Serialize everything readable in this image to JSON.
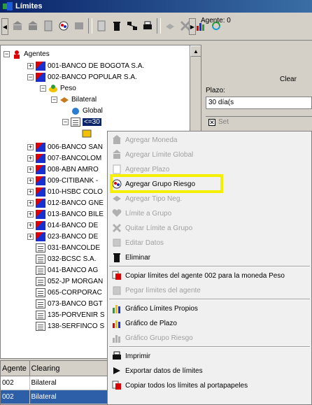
{
  "window": {
    "title": "Límites"
  },
  "toolbar": {
    "icons": [
      "bank-icon",
      "bank-icon",
      "calculator-icon",
      "group-risk-icon",
      "filter-icon",
      "document-icon",
      "trash-icon",
      "network-icon",
      "print-icon",
      "handshake-icon",
      "cross-icon",
      "chart-icon",
      "refresh-icon"
    ]
  },
  "right_pane": {
    "agente_label": "Agente: 0",
    "clear_label": "Clear",
    "plazo_label": "Plazo:",
    "plazo_value": "30 día(s",
    "check_label": "Set"
  },
  "tree": {
    "root": "Agentes",
    "nodes": [
      {
        "label": "001-BANCO DE BOGOTA S.A."
      },
      {
        "label": "002-BANCO POPULAR S.A."
      },
      {
        "label": "Peso"
      },
      {
        "label": "Bilateral"
      },
      {
        "label": "Global"
      },
      {
        "label": "<=30"
      },
      {
        "label": "006-BANCO SAN"
      },
      {
        "label": "007-BANCOLOM"
      },
      {
        "label": "008-ABN AMRO"
      },
      {
        "label": "009-CITIBANK -"
      },
      {
        "label": "010-HSBC COLO"
      },
      {
        "label": "012-BANCO GNE"
      },
      {
        "label": "013-BANCO BILE"
      },
      {
        "label": "014-BANCO DE"
      },
      {
        "label": "023-BANCO DE"
      },
      {
        "label": "031-BANCOLDE"
      },
      {
        "label": "032-BCSC S.A."
      },
      {
        "label": "041-BANCO AG"
      },
      {
        "label": "052-JP MORGAN"
      },
      {
        "label": "065-CORPORAC"
      },
      {
        "label": "073-BANCO BGT"
      },
      {
        "label": "135-PORVENIR S"
      },
      {
        "label": "138-SERFINCO S"
      }
    ]
  },
  "grid": {
    "headers": [
      "Agente",
      "Clearing"
    ],
    "rows": [
      [
        "002",
        "Bilateral"
      ],
      [
        "002",
        "Bilateral"
      ]
    ]
  },
  "context_menu": {
    "items": [
      {
        "label": "Agregar Moneda",
        "enabled": false
      },
      {
        "label": "Agregar Límite Global",
        "enabled": false
      },
      {
        "label": "Agregar Plazo",
        "enabled": false
      },
      {
        "label": "Agregar Grupo Riesgo",
        "enabled": true
      },
      {
        "label": "Agregar Tipo Neg.",
        "enabled": false
      },
      {
        "label": "Límite a Grupo",
        "enabled": false
      },
      {
        "label": "Quitar Límite a Grupo",
        "enabled": false
      },
      {
        "label": "Editar Datos",
        "enabled": false
      },
      {
        "label": "Eliminar",
        "enabled": true
      },
      {
        "label": "Copiar límites del agente 002 para la moneda Peso",
        "enabled": true
      },
      {
        "label": "Pegar límites del agente",
        "enabled": false
      },
      {
        "label": "Gráfico Límites Propios",
        "enabled": true
      },
      {
        "label": "Gráfico de Plazo",
        "enabled": true
      },
      {
        "label": "Gráfico Grupo Riesgo",
        "enabled": false
      },
      {
        "label": "Imprimir",
        "enabled": true
      },
      {
        "label": "Exportar datos de límites",
        "enabled": true
      },
      {
        "label": "Copiar todos los límites al portapapeles",
        "enabled": true
      }
    ]
  },
  "colors": {
    "highlight": "#f5f000",
    "selection": "#0a246a",
    "title_start": "#0a246a"
  }
}
